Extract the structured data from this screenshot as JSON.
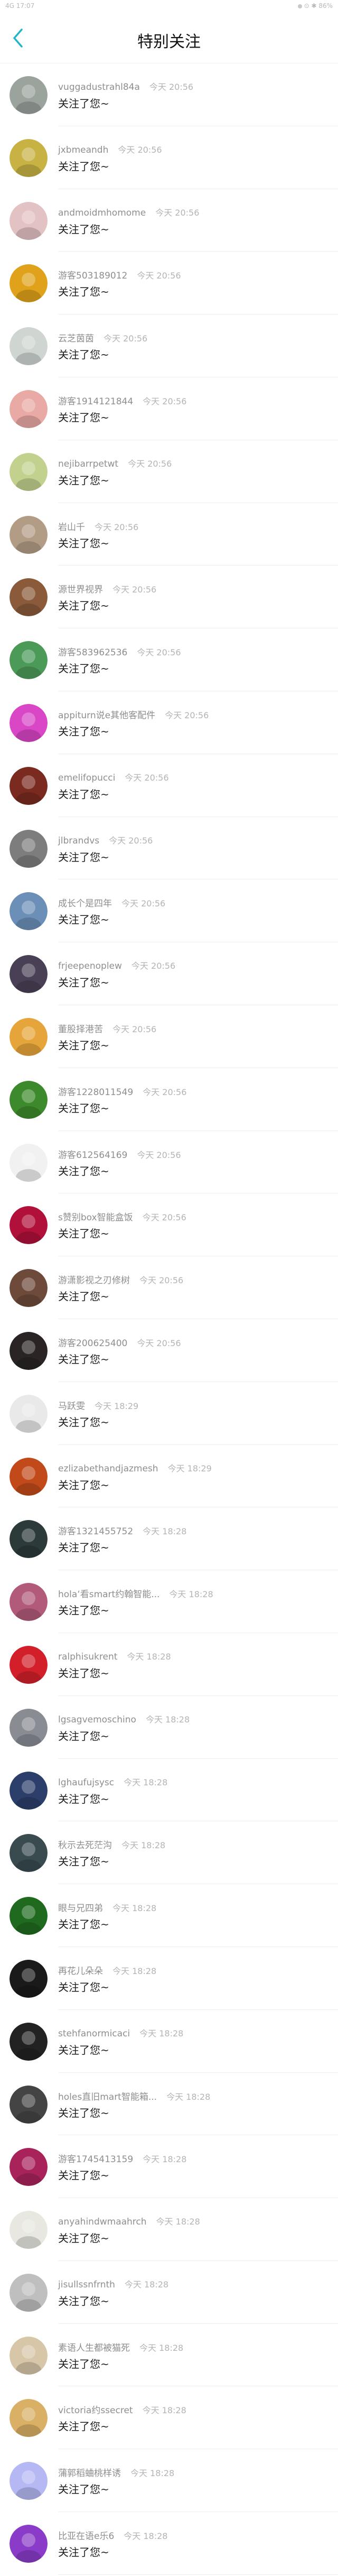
{
  "statusbar": {
    "left_text": "4G 17:07",
    "right_text": "⊙ ✱ 86%"
  },
  "header": {
    "title": "特别关注"
  },
  "message_text": "关注了您~",
  "items": [
    {
      "name": "vuggadustrahl84a",
      "time": "今天 20:56",
      "color": "#9aa39c"
    },
    {
      "name": "jxbmeandh",
      "time": "今天 20:56",
      "color": "#c8b244"
    },
    {
      "name": "andmoidmhomome",
      "time": "今天 20:56",
      "color": "#e3c2c4"
    },
    {
      "name": "游客503189012",
      "time": "今天 20:56",
      "color": "#e0a21a"
    },
    {
      "name": "云芝茵茵",
      "time": "今天 20:56",
      "color": "#cfd6d2"
    },
    {
      "name": "游客1914121844",
      "time": "今天 20:56",
      "color": "#e9a9a4"
    },
    {
      "name": "nejibarrpetwt",
      "time": "今天 20:56",
      "color": "#c2d18e"
    },
    {
      "name": "岩山千",
      "time": "今天 20:56",
      "color": "#b39c86"
    },
    {
      "name": "源世界视界",
      "time": "今天 20:56",
      "color": "#8a5a3a"
    },
    {
      "name": "游客583962536",
      "time": "今天 20:56",
      "color": "#4c9a58"
    },
    {
      "name": "appiturn说e其他客配件",
      "time": "今天 20:56",
      "color": "#d946c6"
    },
    {
      "name": "emelifopucci",
      "time": "今天 20:56",
      "color": "#7a2a1e"
    },
    {
      "name": "jlbrandvs",
      "time": "今天 20:56",
      "color": "#7d7d7d"
    },
    {
      "name": "成长个是四年",
      "time": "今天 20:56",
      "color": "#6c8fb8"
    },
    {
      "name": "frjeepenoplew",
      "time": "今天 20:56",
      "color": "#4a4055"
    },
    {
      "name": "董股择港苦",
      "time": "今天 20:56",
      "color": "#e6a53a"
    },
    {
      "name": "游客1228011549",
      "time": "今天 20:56",
      "color": "#3d8a2c"
    },
    {
      "name": "游客612564169",
      "time": "今天 20:56",
      "color": "#f1f1f1"
    },
    {
      "name": "s赞别box智能盒饭",
      "time": "今天 20:56",
      "color": "#b0103a"
    },
    {
      "name": "游潇影视之刃修树",
      "time": "今天 20:56",
      "color": "#6e4a3a"
    },
    {
      "name": "游客200625400",
      "time": "今天 20:56",
      "color": "#2a2424"
    },
    {
      "name": "马跃雯",
      "time": "今天 18:29",
      "color": "#e9e9e9"
    },
    {
      "name": "ezlizabethandjazmesh",
      "time": "今天 18:29",
      "color": "#c24a1a"
    },
    {
      "name": "游客1321455752",
      "time": "今天 18:28",
      "color": "#2c3a3a"
    },
    {
      "name": "holaʻ看smart约翰智能...",
      "time": "今天 18:28",
      "color": "#b15a7a"
    },
    {
      "name": "ralphisukrent",
      "time": "今天 18:28",
      "color": "#d21f2a"
    },
    {
      "name": "lgsagvemoschino",
      "time": "今天 18:28",
      "color": "#8a8c94"
    },
    {
      "name": "lghaufujsysc",
      "time": "今天 18:28",
      "color": "#2c3e6a"
    },
    {
      "name": "秋示去死茫沟",
      "time": "今天 18:28",
      "color": "#394b4f"
    },
    {
      "name": "眼与兄四弟",
      "time": "今天 18:28",
      "color": "#1f6a1e"
    },
    {
      "name": "再花儿朵朵",
      "time": "今天 18:28",
      "color": "#1a1a1a"
    },
    {
      "name": "stehfanormicaci",
      "time": "今天 18:28",
      "color": "#222222"
    },
    {
      "name": "holes直旧mart智能箱...",
      "time": "今天 18:28",
      "color": "#444444"
    },
    {
      "name": "游客1745413159",
      "time": "今天 18:28",
      "color": "#a8235a"
    },
    {
      "name": "anyahindwmaahrch",
      "time": "今天 18:28",
      "color": "#e8e8e0"
    },
    {
      "name": "jisullssnfrnth",
      "time": "今天 18:28",
      "color": "#bfbfbf"
    },
    {
      "name": "素语人生都被猫死",
      "time": "今天 18:28",
      "color": "#d7c6a8"
    },
    {
      "name": "victoria约ssecret",
      "time": "今天 18:28",
      "color": "#d9b065"
    },
    {
      "name": "蒲郭稻蛐桃样诱",
      "time": "今天 18:28",
      "color": "#b6b8f3"
    },
    {
      "name": "比亚在语e乐6",
      "time": "今天 18:28",
      "color": "#8a3cc8"
    }
  ]
}
